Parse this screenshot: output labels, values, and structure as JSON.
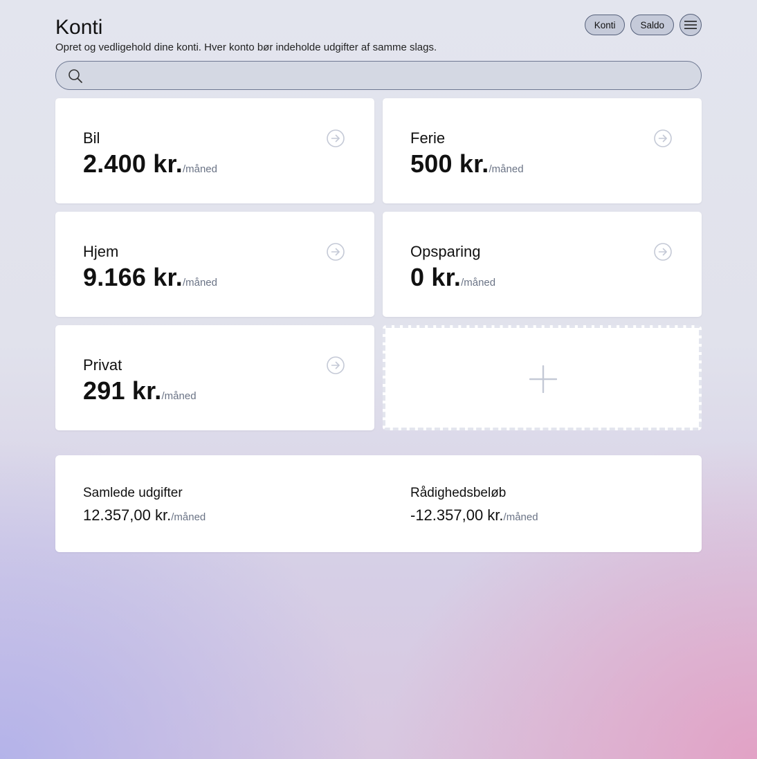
{
  "header": {
    "title": "Konti",
    "subtitle": "Opret og vedligehold dine konti. Hver konto bør indeholde udgifter af samme slags.",
    "nav": {
      "konti_label": "Konti",
      "saldo_label": "Saldo",
      "menu_icon": "hamburger-menu-icon"
    }
  },
  "search": {
    "value": "",
    "placeholder": "",
    "icon": "search-icon"
  },
  "accounts": [
    {
      "name": "Bil",
      "amount": "2.400 kr.",
      "period": "/måned",
      "icon": "arrow-right-circle-icon"
    },
    {
      "name": "Ferie",
      "amount": "500 kr.",
      "period": "/måned",
      "icon": "arrow-right-circle-icon"
    },
    {
      "name": "Hjem",
      "amount": "9.166 kr.",
      "period": "/måned",
      "icon": "arrow-right-circle-icon"
    },
    {
      "name": "Opsparing",
      "amount": "0 kr.",
      "period": "/måned",
      "icon": "arrow-right-circle-icon"
    },
    {
      "name": "Privat",
      "amount": "291 kr.",
      "period": "/måned",
      "icon": "arrow-right-circle-icon"
    }
  ],
  "add_account": {
    "icon": "plus-icon"
  },
  "summary": {
    "total_label": "Samlede udgifter",
    "total_amount": "12.357,00 kr.",
    "total_period": "/måned",
    "available_label": "Rådighedsbeløb",
    "available_amount": "-12.357,00 kr.",
    "available_period": "/måned"
  },
  "colors": {
    "pill_bg": "#c5cad9",
    "pill_border": "#55607a",
    "muted_text": "#6a7385",
    "icon_gray": "#c4c9d6",
    "bg_top": "#e3e5ee",
    "bg_bottom_left": "#b2b2ea",
    "bg_bottom_right": "#e2a0c4"
  }
}
